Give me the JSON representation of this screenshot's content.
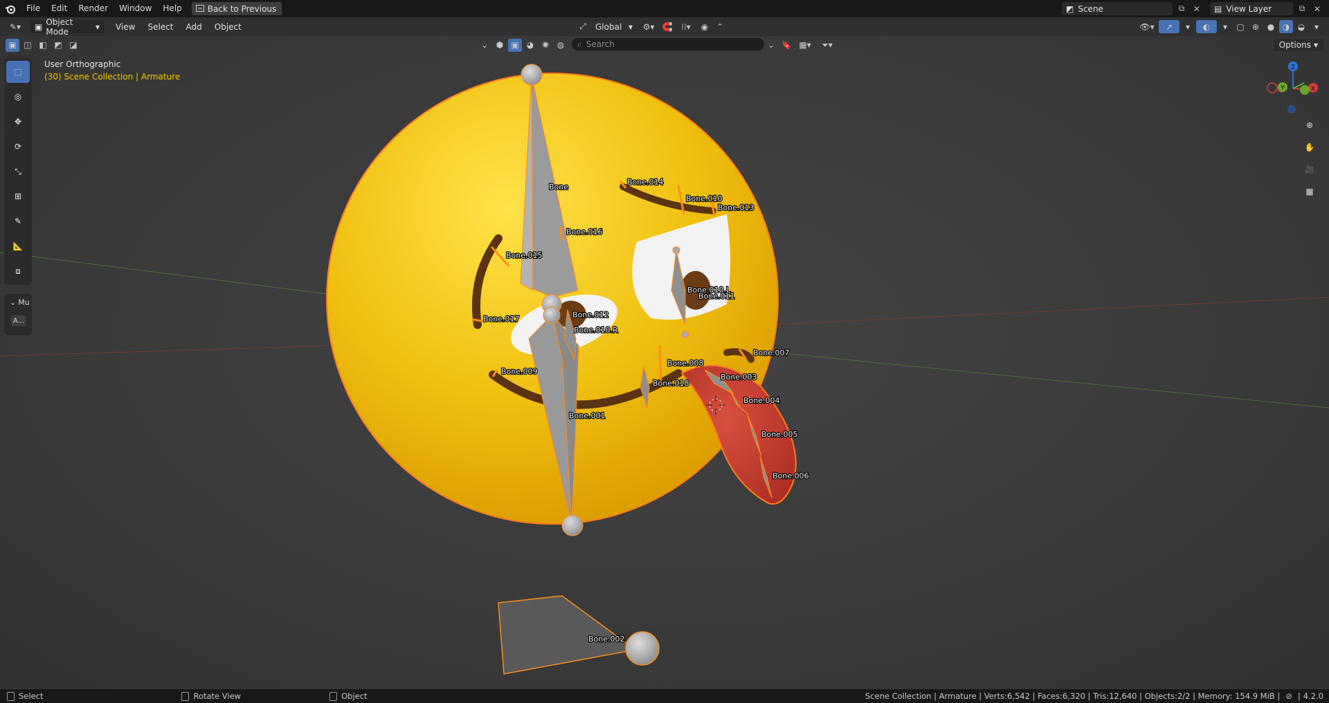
{
  "topbar": {
    "menus": [
      "File",
      "Edit",
      "Render",
      "Window",
      "Help"
    ],
    "back_button": "Back to Previous",
    "scene_name": "Scene",
    "view_layer": "View Layer"
  },
  "header": {
    "mode": "Object Mode",
    "menus": [
      "View",
      "Select",
      "Add",
      "Object"
    ],
    "transform_orientation": "Global",
    "options_label": "Options"
  },
  "search": {
    "placeholder": "Search"
  },
  "viewport": {
    "view_name": "User Orthographic",
    "collection_info": "(30) Scene Collection | Armature",
    "panel_label": "Mu",
    "panel_button": "A..."
  },
  "gizmo": {
    "x": "X",
    "y": "Y",
    "z": "Z"
  },
  "bones": {
    "bone": "Bone",
    "b001": "Bone.001",
    "b002": "Bone.002",
    "b003": "Bone.003",
    "b004": "Bone.004",
    "b005": "Bone.005",
    "b006": "Bone.006",
    "b007": "Bone.007",
    "b008": "Bone.008",
    "b009": "Bone.009",
    "b010": "Bone.010",
    "b011": "Bone.011",
    "b012": "Bone.012",
    "b013": "Bone.013",
    "b014": "Bone.014",
    "b015": "Bone.015",
    "b016": "Bone.016",
    "b017": "Bone.017",
    "b018": "Bone.018",
    "b010R": "Bone.010.R",
    "b010L": "Bone.010.L"
  },
  "statusbar": {
    "select": "Select",
    "rotate": "Rotate View",
    "object": "Object",
    "stats": "Scene Collection | Armature | Verts:6,542 | Faces:6,320 | Tris:12,640 | Objects:2/2 | Memory: 154.9 MiB |",
    "version": "4.2.0"
  },
  "colors": {
    "accent": "#4772b3",
    "selection": "#f2c700",
    "outline": "#ff8c1a"
  }
}
